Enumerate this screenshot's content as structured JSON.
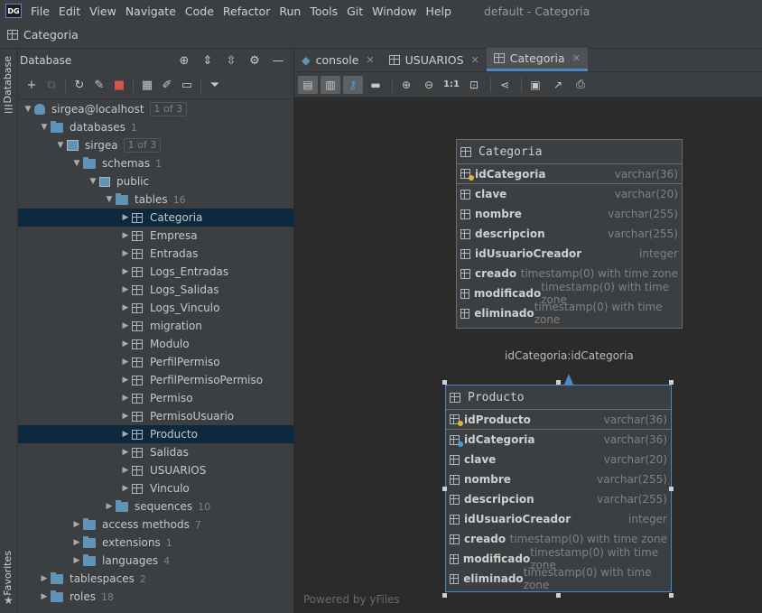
{
  "app": {
    "logo": "DG",
    "window_title": "default - Categoria"
  },
  "menu": [
    "File",
    "Edit",
    "View",
    "Navigate",
    "Code",
    "Refactor",
    "Run",
    "Tools",
    "Git",
    "Window",
    "Help"
  ],
  "navbar": {
    "crumb": "Categoria"
  },
  "left_strip": {
    "database_tab": "Database",
    "favorites_tab": "Favorites"
  },
  "db_panel": {
    "title": "Database"
  },
  "tree": {
    "host": {
      "label": "sirgea@localhost",
      "badge": "1 of 3"
    },
    "databases": {
      "label": "databases",
      "count": "1"
    },
    "db": {
      "label": "sirgea",
      "badge": "1 of 3"
    },
    "schemas": {
      "label": "schemas",
      "count": "1"
    },
    "public": {
      "label": "public"
    },
    "tables": {
      "label": "tables",
      "count": "16"
    },
    "table_items": [
      "Categoria",
      "Empresa",
      "Entradas",
      "Logs_Entradas",
      "Logs_Salidas",
      "Logs_Vinculo",
      "migration",
      "Modulo",
      "PerfilPermiso",
      "PerfilPermisoPermiso",
      "Permiso",
      "PermisoUsuario",
      "Producto",
      "Salidas",
      "USUARIOS",
      "Vinculo"
    ],
    "sequences": {
      "label": "sequences",
      "count": "10"
    },
    "access_methods": {
      "label": "access methods",
      "count": "7"
    },
    "extensions": {
      "label": "extensions",
      "count": "1"
    },
    "languages": {
      "label": "languages",
      "count": "4"
    },
    "tablespaces": {
      "label": "tablespaces",
      "count": "2"
    },
    "roles": {
      "label": "roles",
      "count": "18"
    }
  },
  "tabs": [
    {
      "label": "console"
    },
    {
      "label": "USUARIOS"
    },
    {
      "label": "Categoria"
    }
  ],
  "diagram": {
    "zoom_label": "1:1",
    "relation_label": "idCategoria:idCategoria",
    "powered_by": "Powered by yFiles",
    "categoria": {
      "title": "Categoria",
      "pk": {
        "name": "idCategoria",
        "type": "varchar(36)"
      },
      "columns": [
        {
          "name": "clave",
          "type": "varchar(20)"
        },
        {
          "name": "nombre",
          "type": "varchar(255)"
        },
        {
          "name": "descripcion",
          "type": "varchar(255)"
        },
        {
          "name": "idUsuarioCreador",
          "type": "integer"
        },
        {
          "name": "creado",
          "type": "timestamp(0) with time zone"
        },
        {
          "name": "modificado",
          "type": "timestamp(0) with time zone"
        },
        {
          "name": "eliminado",
          "type": "timestamp(0) with time zone"
        }
      ]
    },
    "producto": {
      "title": "Producto",
      "pk": {
        "name": "idProducto",
        "type": "varchar(36)"
      },
      "columns": [
        {
          "name": "idCategoria",
          "type": "varchar(36)"
        },
        {
          "name": "clave",
          "type": "varchar(20)"
        },
        {
          "name": "nombre",
          "type": "varchar(255)"
        },
        {
          "name": "descripcion",
          "type": "varchar(255)"
        },
        {
          "name": "idUsuarioCreador",
          "type": "integer"
        },
        {
          "name": "creado",
          "type": "timestamp(0) with time zone"
        },
        {
          "name": "modificado",
          "type": "timestamp(0) with time zone"
        },
        {
          "name": "eliminado",
          "type": "timestamp(0) with time zone"
        }
      ]
    }
  }
}
